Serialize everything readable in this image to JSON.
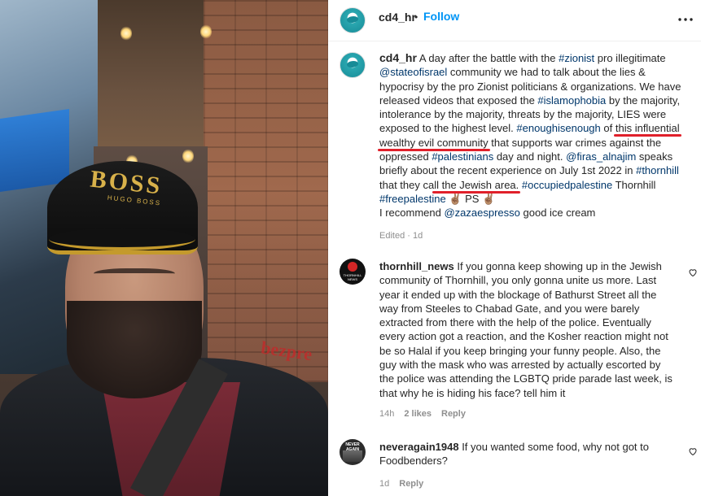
{
  "post": {
    "username": "cd4_hr",
    "follow_label": "Follow",
    "dot": "•",
    "more_label": "•••"
  },
  "photo": {
    "cap_logo": "BOSS",
    "cap_sub": "HUGO BOSS",
    "sign_text": "bezpre"
  },
  "caption": {
    "username": "cd4_hr",
    "t1": " A day after the battle with the ",
    "h1": "#zionist",
    "t2": " pro illegitimate ",
    "h2": "@stateofisrael",
    "t3": " community we had to talk about the lies & hypocrisy by the pro Zionist politicians & organizations. We have released videos that exposed the ",
    "h3": "#islamophobia",
    "t4": " by the majority, intolerance by the majority, threats by the majority, LIES were exposed to the highest level. ",
    "h4": "#enoughisenough",
    "t5": " of ",
    "u1": "this influential",
    "t6": " ",
    "u2": "wealthy evil community",
    "t7": " that supports war crimes against the oppressed ",
    "h5": "#palestinians",
    "t8": " day and night. ",
    "h6": "@firas_alnajim",
    "t9": " speaks briefly about the recent experience on July 1st 2022 in ",
    "h7": "#thornhill",
    "t10": " that they ca",
    "u3": "ll the Jewish area.",
    "t11": " ",
    "h8": "#occupiedpalestine",
    "t12": " Thornhill ",
    "h9": "#freepalestine",
    "t13": " ✌🏽 PS ✌🏽",
    "t14": "I recommend ",
    "h10": "@zazaespresso",
    "t15": " good ice cream",
    "edited": "Edited · 1d"
  },
  "comments": [
    {
      "username": "thornhill_news",
      "text": " If you gonna keep showing up in the Jewish community of Thornhill, you only gonna unite us more. Last year it ended up with the blockage of Bathurst Street all the way from Steeles to Chabad Gate, and you were barely extracted from there with the help of the police. Eventually every action got a reaction, and the Kosher reaction might not be so Halal if you keep bringing your funny people. Also, the guy with the mask who was arrested by actually escorted by the police was attending the LGBTQ pride parade last week, is that why he is hiding his face? tell him it",
      "time": "14h",
      "likes": "2 likes",
      "reply": "Reply",
      "avatar_text": "THORNHILL NEWS"
    },
    {
      "username": "neveragain1948",
      "text": " If you wanted some food, why not got to Foodbenders?",
      "time": "1d",
      "reply": "Reply",
      "avatar_text": "NEVER AGAIN"
    }
  ],
  "colors": {
    "link": "#00376b",
    "follow": "#0095f6",
    "underline": "#e0202a",
    "muted": "#8e8e8e"
  },
  "icons": [
    "more-options-icon",
    "heart-icon"
  ]
}
